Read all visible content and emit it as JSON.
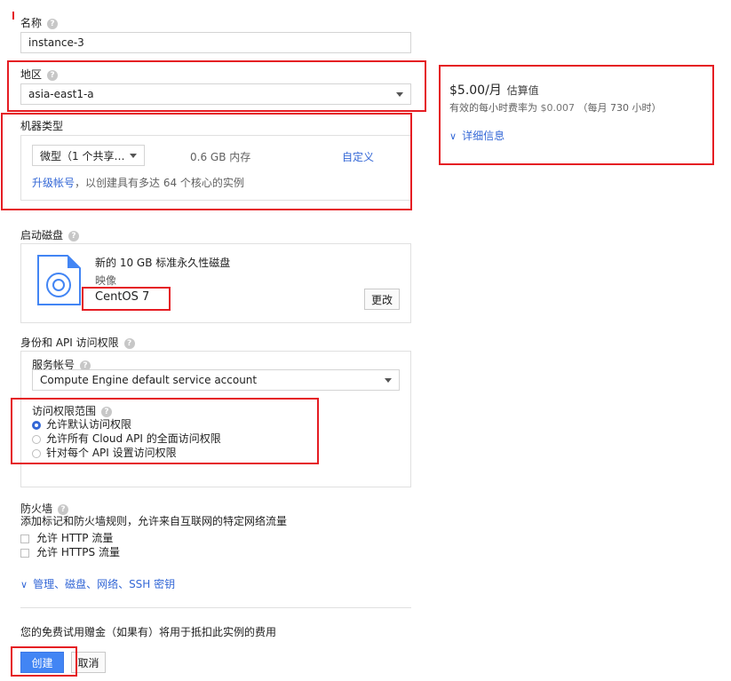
{
  "form": {
    "name_label": "名称",
    "name_value": "instance-3",
    "region_label": "地区",
    "region_value": "asia-east1-a",
    "machine_type_label": "机器类型",
    "machine_type_value": "微型（1 个共享…",
    "memory_text": "0.6 GB 内存",
    "customize_link": "自定义",
    "upgrade_link": "升级帐号",
    "upgrade_text": "，以创建具有多达 64 个核心的实例",
    "boot_disk_label": "启动磁盘",
    "disk_desc": "新的 10 GB 标准永久性磁盘",
    "image_label": "映像",
    "image_value": "CentOS 7",
    "change_button": "更改",
    "identity_label": "身份和 API 访问权限",
    "service_account_label": "服务帐号",
    "service_account_value": "Compute Engine default service account",
    "access_scope_label": "访问权限范围",
    "scope_options": [
      {
        "label": "允许默认访问权限",
        "checked": true
      },
      {
        "label": "允许所有 Cloud API 的全面访问权限",
        "checked": false
      },
      {
        "label": "针对每个 API 设置访问权限",
        "checked": false
      }
    ],
    "firewall_label": "防火墙",
    "firewall_desc": "添加标记和防火墙规则，允许来自互联网的特定网络流量",
    "firewall_options": [
      {
        "label": "允许 HTTP 流量",
        "checked": false
      },
      {
        "label": "允许 HTTPS 流量",
        "checked": false
      }
    ],
    "more_link": "管理、磁盘、网络、SSH 密钥",
    "credit_note": "您的免费试用赠金（如果有）将用于抵扣此实例的费用",
    "create_button": "创建",
    "cancel_button": "取消"
  },
  "pricing": {
    "price": "$5.00/月",
    "estimate": "估算值",
    "hourly_prefix": "有效的每小时费率为",
    "hourly_rate": "$0.007",
    "hourly_suffix": "（每月 730 小时）",
    "details_link": "详细信息"
  },
  "icons": {
    "help": "help-icon",
    "dropdown": "caret-down-icon",
    "disk": "disk-icon",
    "expand": "chevron-down-icon"
  },
  "colors": {
    "link": "#3367d6",
    "primary": "#4285f4",
    "highlight": "#e51c23"
  }
}
